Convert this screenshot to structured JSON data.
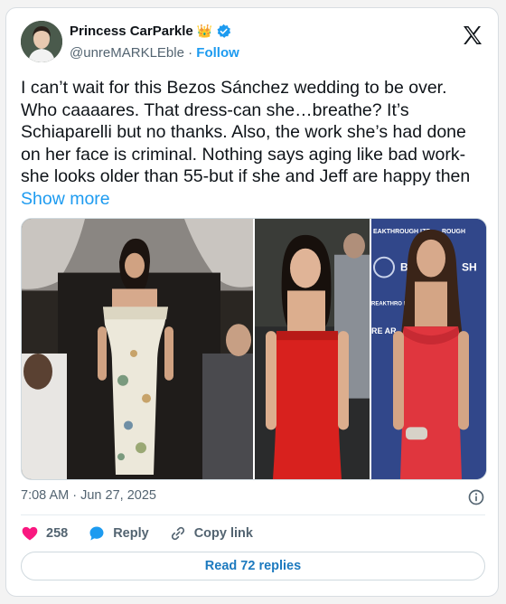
{
  "author": {
    "display_name": "Princess CarParkle",
    "crown_emoji": "👑",
    "handle": "@unreMARKLEble",
    "separator": "·",
    "follow_label": "Follow"
  },
  "tweet": {
    "text": "I can’t wait for this Bezos Sánchez wedding to be over. Who caaaares. That dress-can she…breathe? It’s Schiaparelli but no thanks. Also, the work she’s had done on her face is criminal. Nothing says aging like bad work- she looks older than 55-but if she and Jeff are happy then ",
    "show_more_label": "Show more"
  },
  "media": {
    "banner_text_1": "EAKTHROUGH IZE",
    "banner_text_2": "ROUGH",
    "banner_text_3": "B P",
    "banner_text_4": "SH",
    "banner_text_5": "REAKTHRO IZE",
    "banner_text_6": "RE AR"
  },
  "timestamp": {
    "time": "7:08 AM",
    "separator": "·",
    "date": "Jun 27, 2025"
  },
  "actions": {
    "like_count": "258",
    "reply_label": "Reply",
    "copy_link_label": "Copy link"
  },
  "read_replies_label": "Read 72 replies",
  "colors": {
    "accent": "#1d9bf0",
    "like": "#f91880",
    "text": "#0f1419",
    "muted": "#536471"
  }
}
